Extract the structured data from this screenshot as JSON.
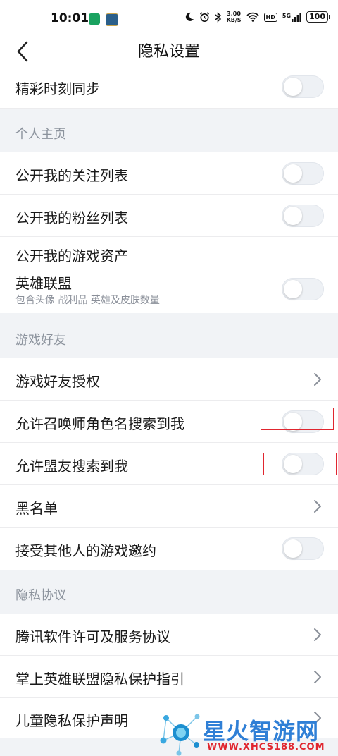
{
  "status_bar": {
    "time": "10:01",
    "net_speed_value": "3.00",
    "net_speed_unit": "KB/S",
    "hd_badge": "HD",
    "signal_badge": "5G",
    "battery": "100"
  },
  "header": {
    "title": "隐私设置"
  },
  "rows": {
    "highlight_sync": "精彩时刻同步",
    "public_follow": "公开我的关注列表",
    "public_fans": "公开我的粉丝列表",
    "public_assets": "公开我的游戏资产",
    "lol_title": "英雄联盟",
    "lol_sub": "包含头像 战利品 英雄及皮肤数量",
    "friend_auth": "游戏好友授权",
    "search_summoner": "允许召唤师角色名搜索到我",
    "search_ally": "允许盟友搜索到我",
    "blacklist": "黑名单",
    "accept_invite": "接受其他人的游戏邀约",
    "license": "腾讯软件许可及服务协议",
    "privacy_guide": "掌上英雄联盟隐私保护指引",
    "child_privacy": "儿童隐私保护声明"
  },
  "sections": {
    "profile": "个人主页",
    "game_friends": "游戏好友",
    "privacy": "隐私协议"
  },
  "toggles": {
    "highlight_sync": false,
    "public_follow": false,
    "public_fans": false,
    "lol_assets": false,
    "search_summoner": false,
    "search_ally": false,
    "accept_invite": false
  },
  "watermark": {
    "name": "星火智游网",
    "url": "WWW.XHCS188.COM"
  },
  "colors": {
    "toggle_off_track": "#eef1f5",
    "section_bg": "#f1f3f6",
    "highlight_border": "#e0262f",
    "watermark_blue": "#2f7fd6",
    "watermark_red": "#e0262f"
  }
}
